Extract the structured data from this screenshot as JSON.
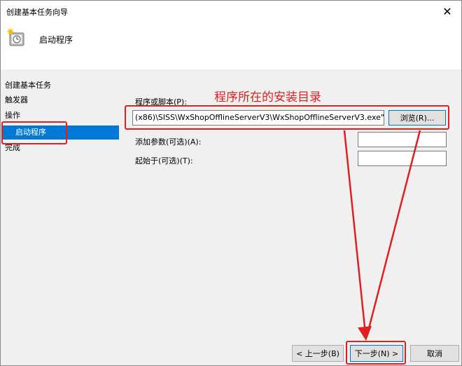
{
  "window": {
    "title": "创建基本任务向导",
    "close_icon": "close-icon"
  },
  "header": {
    "icon": "task-clock-icon",
    "title": "启动程序"
  },
  "sidebar": {
    "heading": "创建基本任务",
    "items": [
      {
        "label": "触发器"
      },
      {
        "label": "操作"
      },
      {
        "label": "启动程序",
        "selected": true
      },
      {
        "label": "完成"
      }
    ]
  },
  "form": {
    "program_label": "程序或脚本(P):",
    "program_value": "(x86)\\SISS\\WxShopOfflineServerV3\\WxShopOfflineServerV3.exe\"",
    "browse_label": "浏览(R)...",
    "args_label": "添加参数(可选)(A):",
    "args_value": "",
    "startin_label": "起始于(可选)(T):",
    "startin_value": ""
  },
  "annotation": {
    "text": "程序所在的安装目录",
    "color": "#e02020"
  },
  "footer": {
    "back_label": "< 上一步(B)",
    "next_label": "下一步(N) >",
    "cancel_label": "取消"
  },
  "colors": {
    "accent": "#0078d7",
    "annotation_red": "#e02020",
    "panel_bg": "#f0f0f0"
  }
}
